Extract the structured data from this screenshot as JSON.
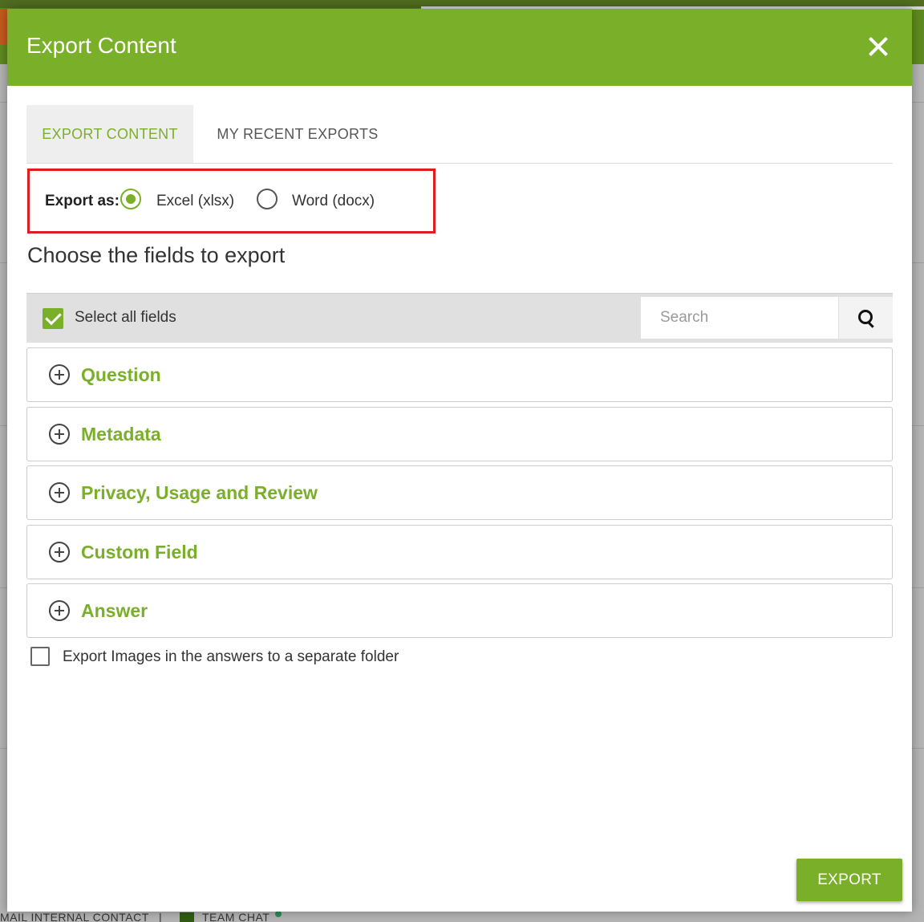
{
  "modal": {
    "title": "Export Content"
  },
  "tabs": [
    {
      "label": "EXPORT CONTENT",
      "active": true
    },
    {
      "label": "MY RECENT EXPORTS",
      "active": false
    }
  ],
  "export_as": {
    "label": "Export as:",
    "options": [
      {
        "label": "Excel (xlsx)",
        "selected": true
      },
      {
        "label": "Word (docx)",
        "selected": false
      }
    ]
  },
  "fields": {
    "title": "Choose the fields to export",
    "select_all_label": "Select all fields",
    "select_all_checked": true,
    "search_placeholder": "Search",
    "sections": [
      {
        "label": "Question"
      },
      {
        "label": "Metadata"
      },
      {
        "label": "Privacy, Usage and Review"
      },
      {
        "label": "Custom Field"
      },
      {
        "label": "Answer"
      }
    ]
  },
  "images_option": {
    "label": "Export Images in the answers to a separate folder",
    "checked": false
  },
  "export_button": {
    "label": "EXPORT"
  },
  "background_footer": {
    "items": [
      "MAIL INTERNAL CONTACT",
      "|",
      "TEAM CHAT"
    ]
  },
  "colors": {
    "accent": "#7aaf2a",
    "highlight_border": "#e11b22"
  }
}
